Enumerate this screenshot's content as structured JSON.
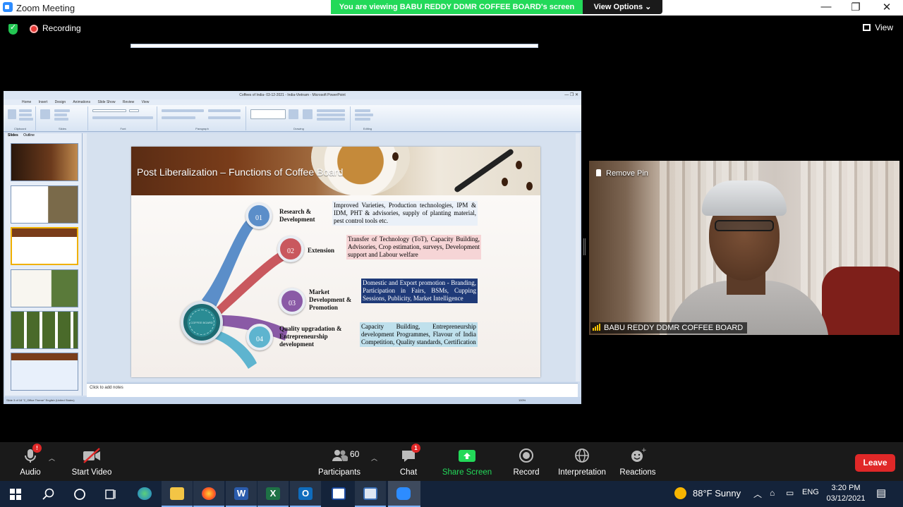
{
  "window": {
    "title": "Zoom Meeting"
  },
  "banner": {
    "viewing": "You are viewing BABU REDDY DDMR COFFEE BOARD's screen",
    "view_options": "View Options"
  },
  "topbar": {
    "recording": "Recording",
    "view": "View"
  },
  "ppt": {
    "title": "Coffees of India- 03-12-2021 - India-Vietnam - Microsoft PowerPoint",
    "tabs": [
      "Home",
      "Insert",
      "Design",
      "Animations",
      "Slide Show",
      "Review",
      "View"
    ],
    "groups": [
      "Clipboard",
      "Slides",
      "Font",
      "Paragraph",
      "Drawing",
      "Editing"
    ],
    "left_tabs": [
      "Slides",
      "Outline"
    ],
    "notes_placeholder": "Click to add notes",
    "status": "Slide 3 of 18    \"2_Office Theme\"    English (United States)",
    "zoom": "100%"
  },
  "slide": {
    "title": "Post Liberalization – Functions of Coffee Board",
    "hub_text": "COFFEE BOARD",
    "functions": [
      {
        "num": "01",
        "label": "Research & Development",
        "desc": "Improved Varieties, Production technologies, IPM & IDM, PHT & advisories, supply of planting material, pest control tools etc.",
        "color": "#5b8ec9"
      },
      {
        "num": "02",
        "label": "Extension",
        "desc": "Transfer of Technology (ToT), Capacity Building, Advisories, Crop estimation, surveys, Development support and Labour welfare",
        "color": "#c9585e"
      },
      {
        "num": "03",
        "label": "Market Development & Promotion",
        "desc": "Domestic and Export promotion - Branding, Participation in Fairs, BSMs, Cupping Sessions, Publicity, Market Intelligence",
        "color": "#8a5aa6"
      },
      {
        "num": "04",
        "label": "Quality upgradation & Entrepreneurship development",
        "desc": "Capacity Building, Entrepreneurship development Programmes, Flavour of India Competition, Quality standards, Certification",
        "color": "#5eb4cf"
      }
    ]
  },
  "video": {
    "remove_pin": "Remove Pin",
    "name": "BABU REDDY DDMR COFFEE BOARD"
  },
  "toolbar": {
    "audio": "Audio",
    "start_video": "Start Video",
    "participants": "Participants",
    "participants_count": "60",
    "chat": "Chat",
    "chat_badge": "1",
    "audio_badge": "!",
    "share_screen": "Share Screen",
    "record": "Record",
    "interpretation": "Interpretation",
    "reactions": "Reactions",
    "leave": "Leave"
  },
  "taskbar": {
    "weather": "88°F  Sunny",
    "lang": "ENG",
    "time": "3:20 PM",
    "date": "03/12/2021"
  },
  "colors": {
    "zoom_green": "#23d959",
    "leave_red": "#e02828",
    "zoom_blue": "#2d8cff"
  }
}
